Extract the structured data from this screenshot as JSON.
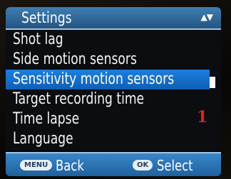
{
  "header": {
    "title": "Settings",
    "scroll_indicator_icon": "up-down-triangle-icon"
  },
  "menu": {
    "items": [
      {
        "label": "Shot lag",
        "selected": false
      },
      {
        "label": "Side motion sensors",
        "selected": false
      },
      {
        "label": "Sensitivity motion sensors",
        "selected": true
      },
      {
        "label": "Target recording time",
        "selected": false
      },
      {
        "label": "Time lapse",
        "selected": false
      },
      {
        "label": "Language",
        "selected": false
      }
    ]
  },
  "annotation": {
    "text": "1",
    "color": "#e0211b"
  },
  "footer": {
    "back_key": "MENU",
    "back_label": "Back",
    "select_key": "OK",
    "select_label": "Select"
  },
  "colors": {
    "header_bg": "#2f6a9c",
    "selection_bg": "#1570cc",
    "footer_bg": "#2c75b6",
    "text": "#ffffff"
  }
}
